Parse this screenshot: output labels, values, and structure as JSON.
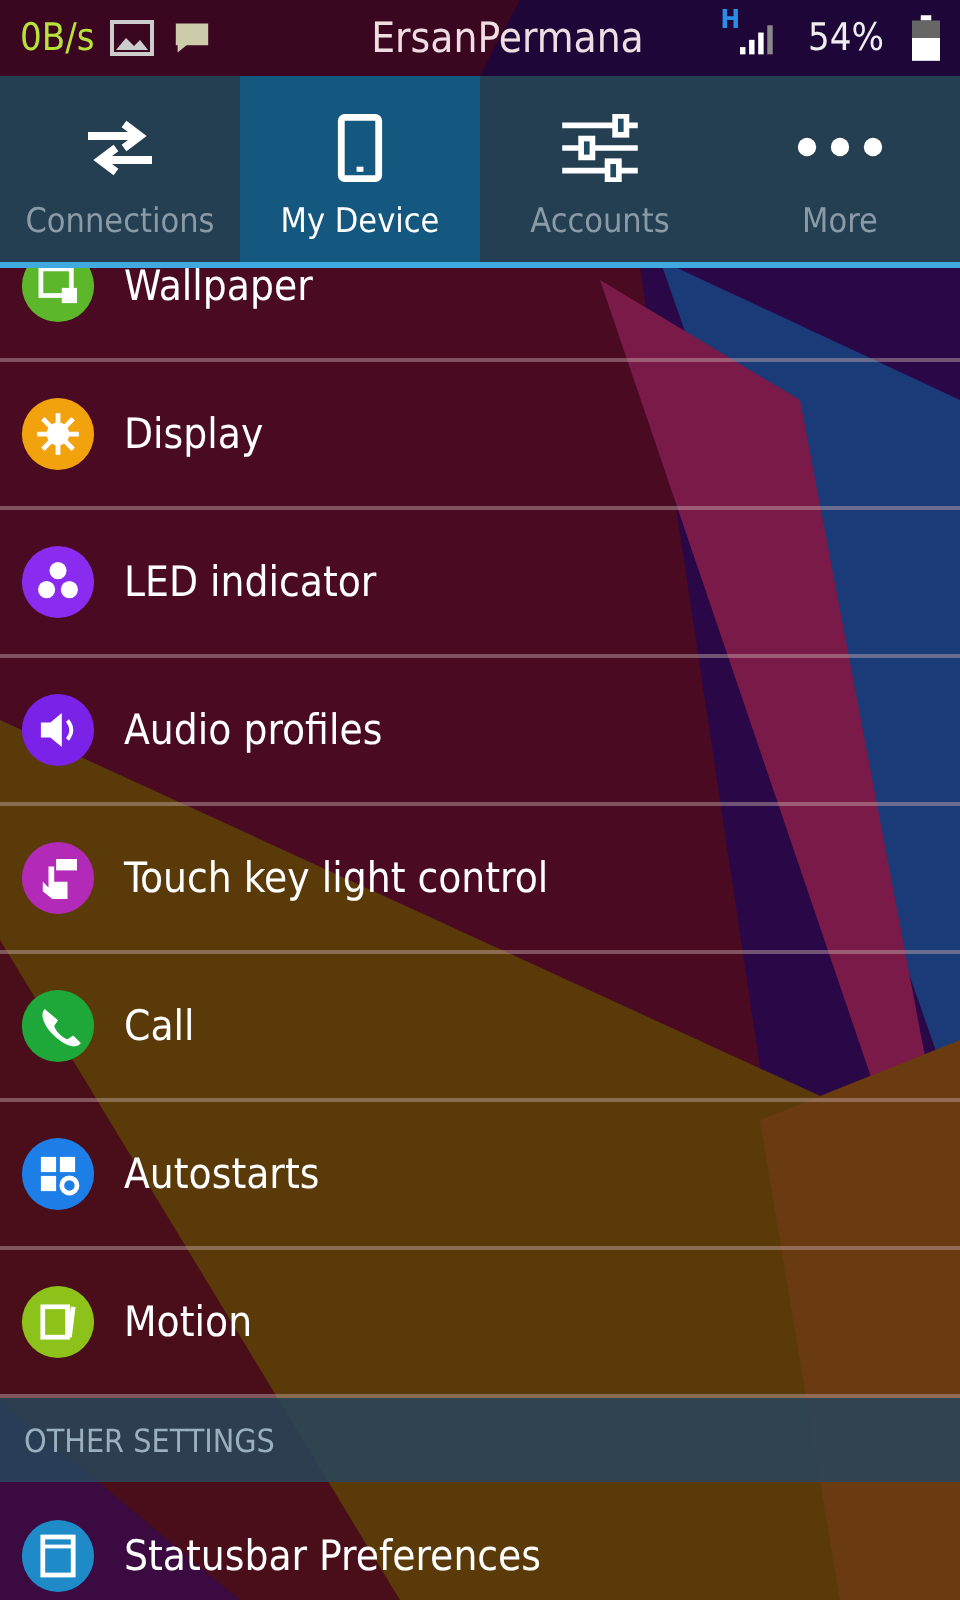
{
  "status_bar": {
    "speed": "0B/s",
    "carrier": "ErsanPermana",
    "network": "H",
    "battery": "54%"
  },
  "tabs": [
    {
      "label": "Connections",
      "selected": false
    },
    {
      "label": "My Device",
      "selected": true
    },
    {
      "label": "Accounts",
      "selected": false
    },
    {
      "label": "More",
      "selected": false
    }
  ],
  "items": [
    {
      "label": "Wallpaper",
      "color": "#5cb82a"
    },
    {
      "label": "Display",
      "color": "#f2a20c"
    },
    {
      "label": "LED indicator",
      "color": "#8a2cf0"
    },
    {
      "label": "Audio profiles",
      "color": "#7a22e8"
    },
    {
      "label": "Touch key light control",
      "color": "#b42ab8"
    },
    {
      "label": "Call",
      "color": "#1fa83a"
    },
    {
      "label": "Autostarts",
      "color": "#1e7ee8"
    },
    {
      "label": "Motion",
      "color": "#8cc21a"
    }
  ],
  "section_header": "OTHER SETTINGS",
  "other_items": [
    {
      "label": "Statusbar Preferences",
      "color": "#1e8ac8"
    }
  ]
}
